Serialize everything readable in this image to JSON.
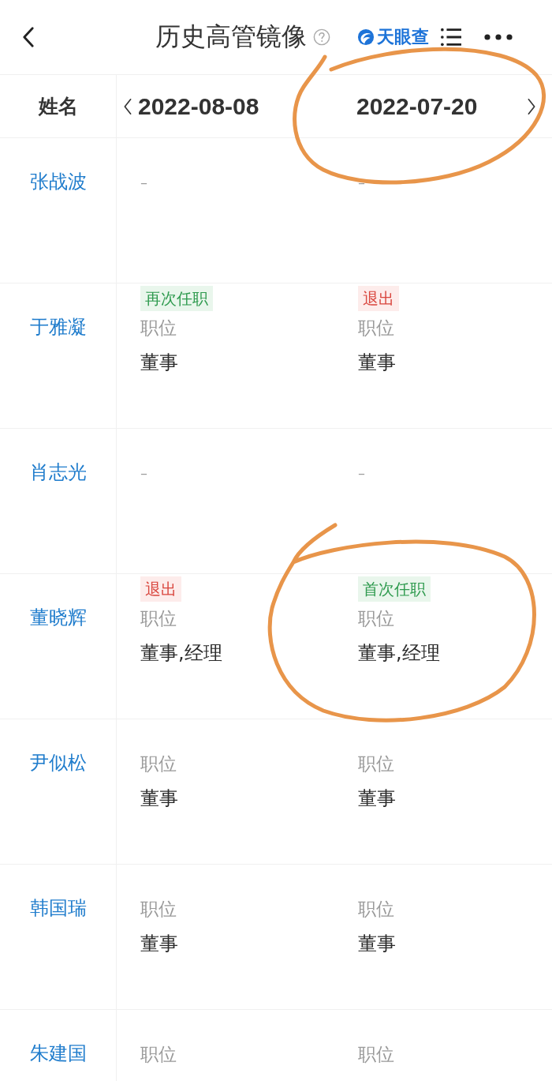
{
  "nav": {
    "title": "历史高管镜像",
    "logo": "天眼查"
  },
  "table": {
    "name_header": "姓名",
    "dates": [
      "2022-08-08",
      "2022-07-20"
    ],
    "rows": [
      {
        "name": "张战波",
        "cells": [
          {
            "kind": "empty",
            "text": "–"
          },
          {
            "kind": "empty",
            "text": "–"
          }
        ]
      },
      {
        "name": "于雅凝",
        "cells": [
          {
            "kind": "position",
            "tag": {
              "text": "再次任职",
              "kind": "appointed"
            },
            "label": "职位",
            "value": "董事"
          },
          {
            "kind": "position",
            "tag": {
              "text": "退出",
              "kind": "exited"
            },
            "label": "职位",
            "value": "董事"
          }
        ]
      },
      {
        "name": "肖志光",
        "cells": [
          {
            "kind": "empty",
            "text": "–"
          },
          {
            "kind": "empty",
            "text": "–"
          }
        ]
      },
      {
        "name": "董晓辉",
        "cells": [
          {
            "kind": "position",
            "tag": {
              "text": "退出",
              "kind": "exited"
            },
            "label": "职位",
            "value": "董事,经理"
          },
          {
            "kind": "position",
            "tag": {
              "text": "首次任职",
              "kind": "appointed"
            },
            "label": "职位",
            "value": "董事,经理"
          }
        ]
      },
      {
        "name": "尹似松",
        "cells": [
          {
            "kind": "position",
            "label": "职位",
            "value": "董事"
          },
          {
            "kind": "position",
            "label": "职位",
            "value": "董事"
          }
        ]
      },
      {
        "name": "韩国瑞",
        "cells": [
          {
            "kind": "position",
            "label": "职位",
            "value": "董事"
          },
          {
            "kind": "position",
            "label": "职位",
            "value": "董事"
          }
        ]
      },
      {
        "name": "朱建国",
        "cells": [
          {
            "kind": "position",
            "label": "职位"
          },
          {
            "kind": "position",
            "label": "职位"
          }
        ]
      }
    ]
  }
}
